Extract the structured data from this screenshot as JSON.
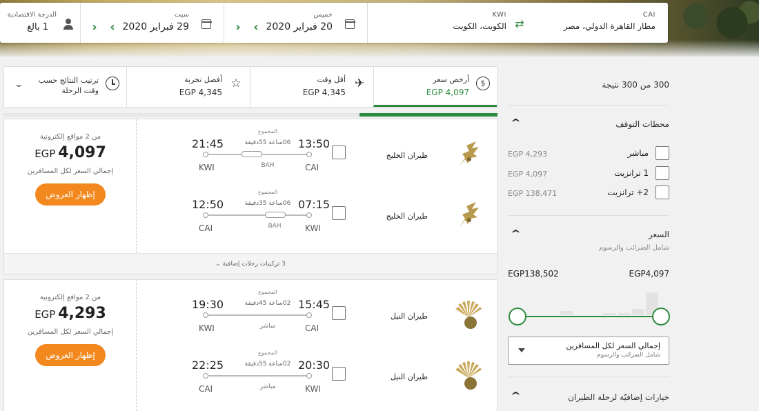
{
  "search": {
    "origin_code": "CAI",
    "origin_name": "مطار القاهرة الدولي، مصر",
    "destination_code": "KWI",
    "destination_name": "الكويت، الكويت",
    "depart_day": "خميس",
    "depart_date": "20 فبراير 2020",
    "return_day": "سبت",
    "return_date": "29 فبراير 2020",
    "cabin_label": "الدرجة الاقتصادية",
    "passengers": "1 بالغ",
    "prev_symbol": "‹",
    "next_symbol": "›"
  },
  "sort_tabs": [
    {
      "label": "أرخص سعر",
      "price": "EGP 4,097",
      "icon": "dollar-circle-icon",
      "selected": true
    },
    {
      "label": "أقل وقت",
      "price": "EGP 4,345",
      "icon": "fast-plane-icon"
    },
    {
      "label": "أفضل تجربة",
      "price": "EGP 4,345",
      "icon": "star-icon"
    },
    {
      "label": "ترتيب النتائج حسب وقت الرحلة",
      "icon": "clock-icon"
    }
  ],
  "progress_fraction": 0.28,
  "filters": {
    "result_count": "300 من 300 نتيجة",
    "stops_title": "محطات التوقف",
    "stops": [
      {
        "label": "مباشر",
        "price": "EGP 4,293"
      },
      {
        "label": "1 ترانزيت",
        "price": "EGP 4,097"
      },
      {
        "label": "2+ ترانزيت",
        "price": "EGP 138,471"
      }
    ],
    "price_title": "السعر",
    "price_subtitle": "شامل الضرائب والرسوم",
    "price_min": "EGP4,097",
    "price_max": "EGP138,502",
    "price_mode_main": "إجمالي السعر لكل المسافرين",
    "price_mode_sub": "شامل الضرائب والرسوم",
    "extra_title": "خيارات إضافيّة لرحلة الطيران"
  },
  "results": [
    {
      "sites": "من 2 مواقع إلكترونية",
      "currency": "EGP",
      "amount": "4,097",
      "total_note": "إجمالي السعر لكل المسافرين",
      "button": "إظهار العروض",
      "more": "3 تركيبات رحلات إضافية",
      "legs": [
        {
          "airline": "طيران الخليج",
          "dep_time": "13:50",
          "dep_code": "CAI",
          "arr_time": "21:45",
          "arr_code": "KWI",
          "total_label": "المجموع",
          "duration": "06ساعة 55دقيقة",
          "stop": "BAH"
        },
        {
          "airline": "طيران الخليج",
          "dep_time": "07:15",
          "dep_code": "KWI",
          "arr_time": "12:50",
          "arr_code": "CAI",
          "total_label": "المجموع",
          "duration": "06ساعة 35دقيقة",
          "stop": "BAH"
        }
      ]
    },
    {
      "sites": "من 2 مواقع إلكترونية",
      "currency": "EGP",
      "amount": "4,293",
      "total_note": "إجمالي السعر لكل المسافرين",
      "button": "إظهار العروض",
      "legs": [
        {
          "airline": "طيران النيل",
          "dep_time": "15:45",
          "dep_code": "CAI",
          "arr_time": "19:30",
          "arr_code": "KWI",
          "total_label": "المجموع",
          "duration": "02ساعة 45دقيقة",
          "stop": "مباشر"
        },
        {
          "airline": "طيران النيل",
          "dep_time": "20:30",
          "dep_code": "KWI",
          "arr_time": "22:25",
          "arr_code": "CAI",
          "total_label": "المجموع",
          "duration": "02ساعة 55دقيقة",
          "stop": "مباشر"
        }
      ]
    }
  ],
  "colors": {
    "accent": "#2e8b3e",
    "cta": "#f3891e"
  }
}
